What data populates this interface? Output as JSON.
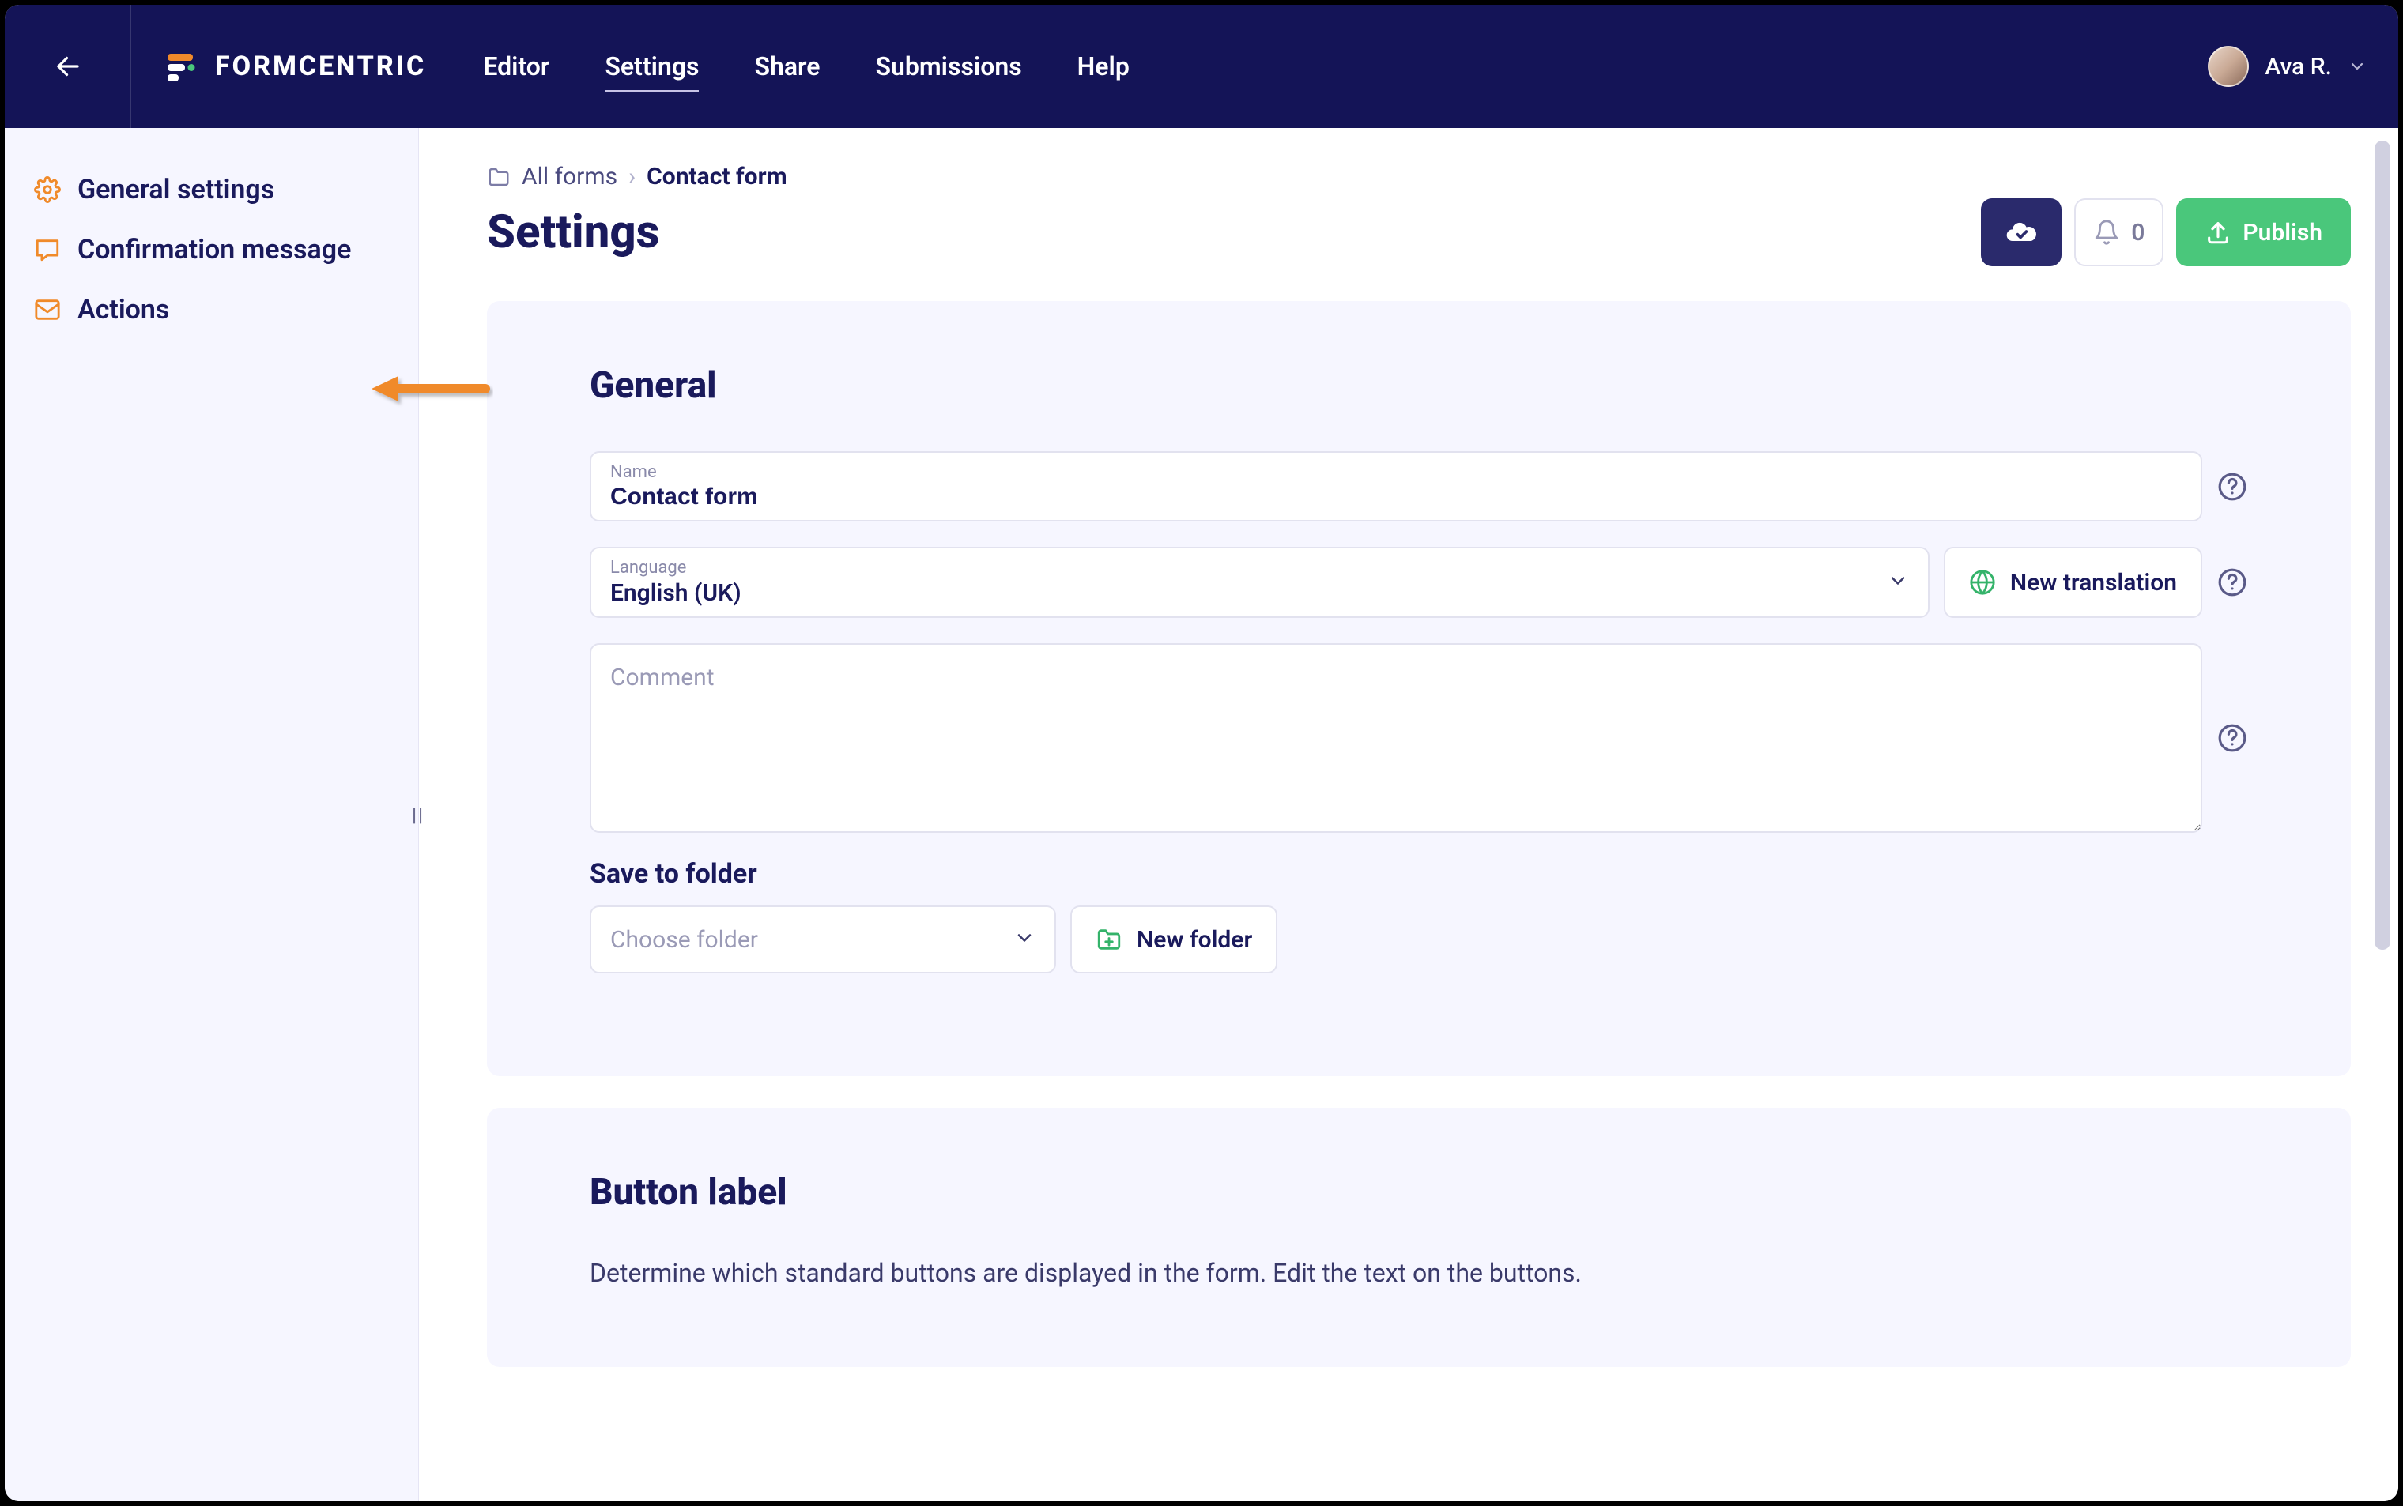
{
  "header": {
    "logo_text": "FORMCENTRIC",
    "nav": {
      "editor": "Editor",
      "settings": "Settings",
      "share": "Share",
      "submissions": "Submissions",
      "help": "Help"
    },
    "user_name": "Ava R."
  },
  "sidebar": {
    "items": [
      {
        "label": "General settings",
        "icon": "gear"
      },
      {
        "label": "Confirmation message",
        "icon": "comment"
      },
      {
        "label": "Actions",
        "icon": "mail"
      }
    ]
  },
  "breadcrumb": {
    "all_forms": "All forms",
    "current": "Contact form"
  },
  "page_title": "Settings",
  "actions": {
    "notification_count": "0",
    "publish": "Publish"
  },
  "general_card": {
    "title": "General",
    "name_label": "Name",
    "name_value": "Contact form",
    "language_label": "Language",
    "language_value": "English (UK)",
    "new_translation": "New translation",
    "comment_placeholder": "Comment",
    "save_to_folder_label": "Save to folder",
    "choose_folder_placeholder": "Choose folder",
    "new_folder": "New folder"
  },
  "button_label_card": {
    "title": "Button label",
    "description": "Determine which standard buttons are displayed in the form. Edit the text on the buttons."
  },
  "colors": {
    "accent_orange": "#f08a2a",
    "navy": "#141457",
    "green": "#4ac77b"
  }
}
